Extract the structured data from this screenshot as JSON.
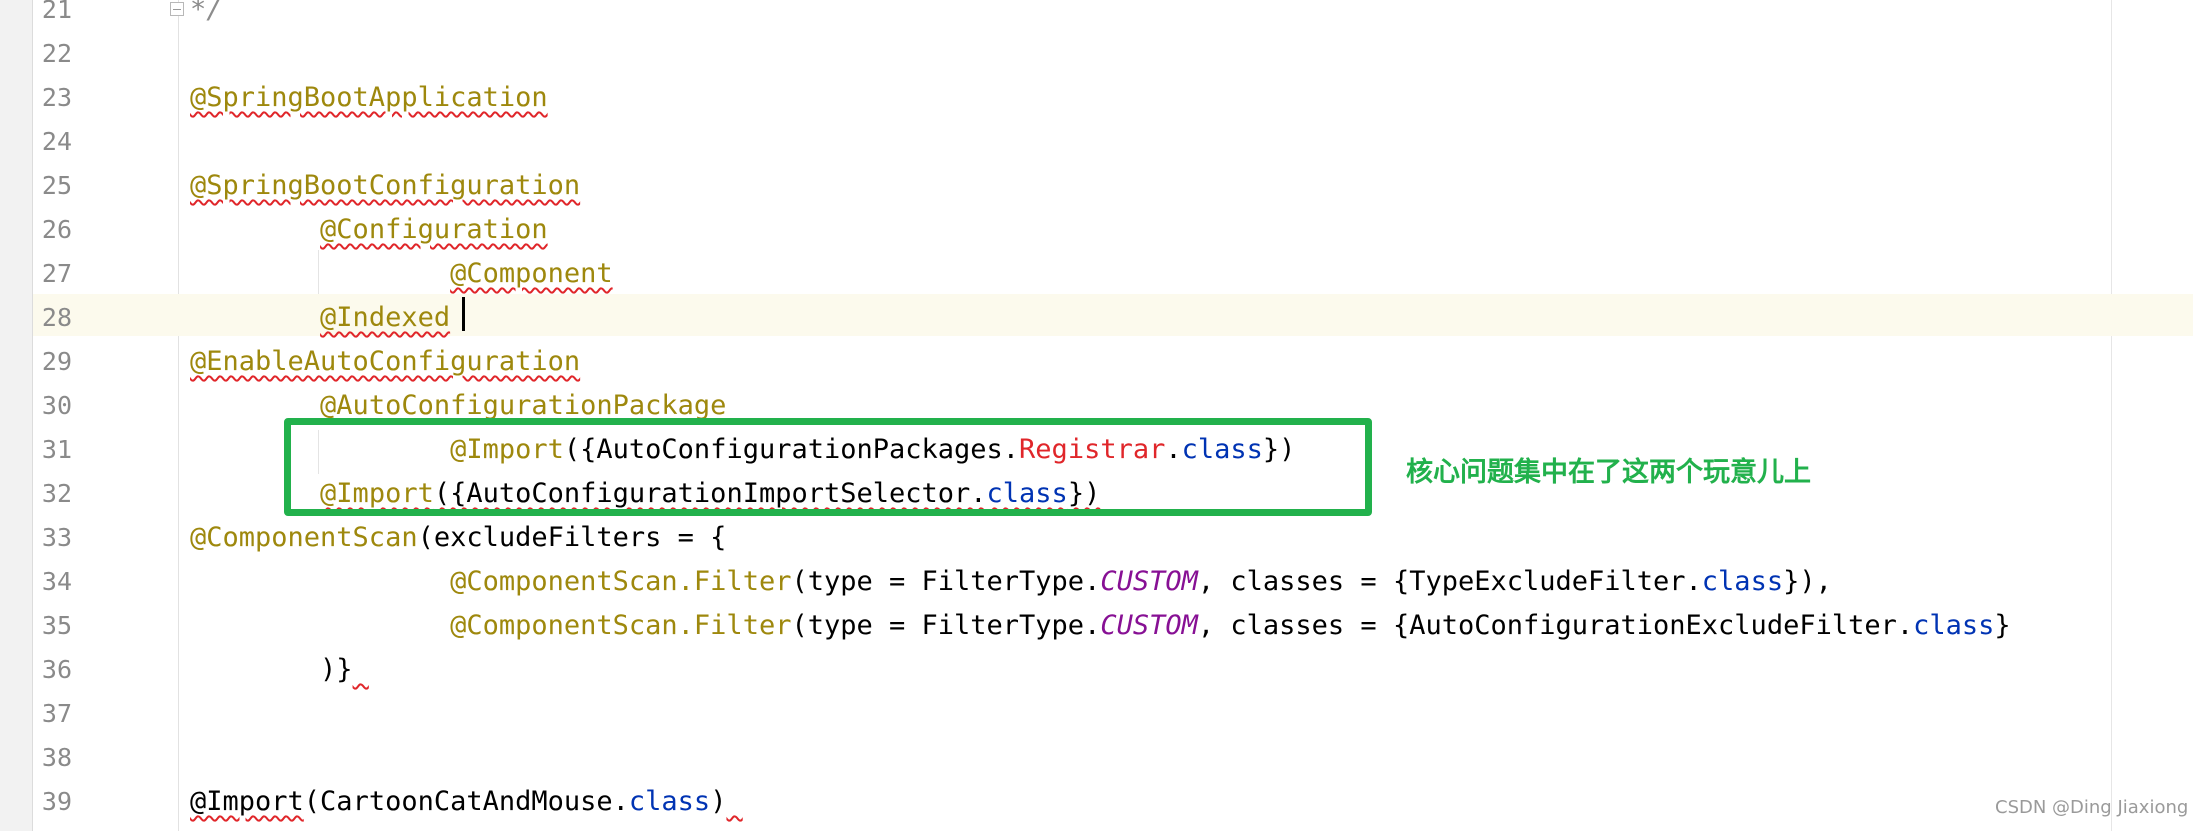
{
  "editor": {
    "lines": [
      {
        "no": "21",
        "tokens": [
          {
            "t": "*/",
            "c": "cmt"
          }
        ]
      },
      {
        "no": "22",
        "tokens": []
      },
      {
        "no": "23",
        "tokens": [
          {
            "t": "@SpringBootApplication",
            "c": "ann squig"
          }
        ]
      },
      {
        "no": "24",
        "tokens": []
      },
      {
        "no": "25",
        "tokens": [
          {
            "t": "@SpringBootConfiguration",
            "c": "ann squig"
          }
        ]
      },
      {
        "no": "26",
        "tokens": [
          {
            "t": "        "
          },
          {
            "t": "@Configuration",
            "c": "ann squig"
          }
        ]
      },
      {
        "no": "27",
        "tokens": [
          {
            "t": "                "
          },
          {
            "t": "@Component",
            "c": "ann squig"
          }
        ]
      },
      {
        "no": "28",
        "tokens": [
          {
            "t": "        "
          },
          {
            "t": "@Indexed",
            "c": "ann squig"
          }
        ]
      },
      {
        "no": "29",
        "tokens": [
          {
            "t": "@EnableAutoConfiguration",
            "c": "ann squig"
          }
        ]
      },
      {
        "no": "30",
        "tokens": [
          {
            "t": "        "
          },
          {
            "t": "@AutoConfigurationPackage",
            "c": "ann"
          }
        ]
      },
      {
        "no": "31",
        "tokens": [
          {
            "t": "                "
          },
          {
            "t": "@Import",
            "c": "ann"
          },
          {
            "t": "({AutoConfigurationPackages."
          },
          {
            "t": "Registrar",
            "c": "red"
          },
          {
            "t": "."
          },
          {
            "t": "class",
            "c": "kw"
          },
          {
            "t": "})"
          }
        ]
      },
      {
        "no": "32",
        "tokens": [
          {
            "t": "        "
          },
          {
            "t": "@Import",
            "c": "ann squig"
          },
          {
            "t": "({AutoConfigurationImportSelector.",
            "c": "squig"
          },
          {
            "t": "class",
            "c": "kw squig"
          },
          {
            "t": "})",
            "c": "squig"
          }
        ]
      },
      {
        "no": "33",
        "tokens": [
          {
            "t": "@ComponentScan",
            "c": "ann"
          },
          {
            "t": "(excludeFilters = {"
          }
        ]
      },
      {
        "no": "34",
        "tokens": [
          {
            "t": "                "
          },
          {
            "t": "@ComponentScan.Filter",
            "c": "ann"
          },
          {
            "t": "(type = FilterType."
          },
          {
            "t": "CUSTOM",
            "c": "purple"
          },
          {
            "t": ", classes = {TypeExcludeFilter."
          },
          {
            "t": "class",
            "c": "kw"
          },
          {
            "t": "}),"
          }
        ]
      },
      {
        "no": "35",
        "tokens": [
          {
            "t": "                "
          },
          {
            "t": "@ComponentScan.Filter",
            "c": "ann"
          },
          {
            "t": "(type = FilterType."
          },
          {
            "t": "CUSTOM",
            "c": "purple"
          },
          {
            "t": ", classes = {AutoConfigurationExcludeFilter."
          },
          {
            "t": "class",
            "c": "kw"
          },
          {
            "t": "}"
          }
        ]
      },
      {
        "no": "36",
        "tokens": [
          {
            "t": "        "
          },
          {
            "t": ")}"
          },
          {
            "t": " ",
            "c": "squig"
          }
        ]
      },
      {
        "no": "37",
        "tokens": []
      },
      {
        "no": "38",
        "tokens": []
      },
      {
        "no": "39",
        "tokens": [
          {
            "t": "@Import",
            "c": "squig"
          },
          {
            "t": "(CartoonCatAndMouse."
          },
          {
            "t": "class",
            "c": "kw"
          },
          {
            "t": ")"
          },
          {
            "t": " ",
            "c": "squig"
          }
        ]
      }
    ]
  },
  "annotation": {
    "note": "核心问题集中在了这两个玩意儿上",
    "box_color": "#22b14c"
  },
  "watermark": "CSDN @Ding Jiaxiong",
  "colors": {
    "annotation": "#9e880d",
    "keyword": "#0033b3",
    "error": "#e0262a",
    "constant": "#871094",
    "current_line": "#fcfaed"
  }
}
